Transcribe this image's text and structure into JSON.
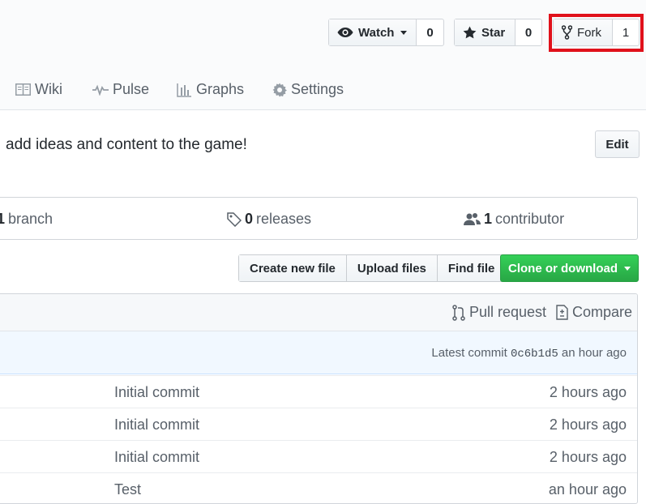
{
  "actions": {
    "watch": {
      "label": "Watch",
      "count": "0"
    },
    "star": {
      "label": "Star",
      "count": "0"
    },
    "fork": {
      "label": "Fork",
      "count": "1"
    }
  },
  "highlight_color": "#e0111b",
  "nav": [
    {
      "label": "Wiki",
      "icon": "book-icon"
    },
    {
      "label": "Pulse",
      "icon": "pulse-icon"
    },
    {
      "label": "Graphs",
      "icon": "graph-icon"
    },
    {
      "label": "Settings",
      "icon": "gear-icon"
    }
  ],
  "description": {
    "text": "add ideas and content to the game!",
    "edit_label": "Edit"
  },
  "summary": {
    "branch": {
      "count": "1",
      "label": "branch"
    },
    "releases": {
      "count": "0",
      "label": "releases",
      "icon": "tag-icon"
    },
    "contributors": {
      "count": "1",
      "label": "contributor",
      "icon": "people-icon"
    }
  },
  "file_buttons": {
    "create": "Create new file",
    "upload": "Upload files",
    "find": "Find file",
    "clone": "Clone or download"
  },
  "table": {
    "pull_request": "Pull request",
    "compare": "Compare",
    "latest_commit_label": "Latest commit",
    "latest_commit_sha": "0c6b1d5",
    "latest_commit_age": "an hour ago",
    "rows": [
      {
        "message": "Initial commit",
        "age": "2 hours ago"
      },
      {
        "message": "Initial commit",
        "age": "2 hours ago"
      },
      {
        "message": "Initial commit",
        "age": "2 hours ago"
      },
      {
        "message": "Test",
        "age": "an hour ago"
      }
    ]
  },
  "colors": {
    "clone_green": "#28a745",
    "commit_bar_bg": "#f1f8ff"
  }
}
